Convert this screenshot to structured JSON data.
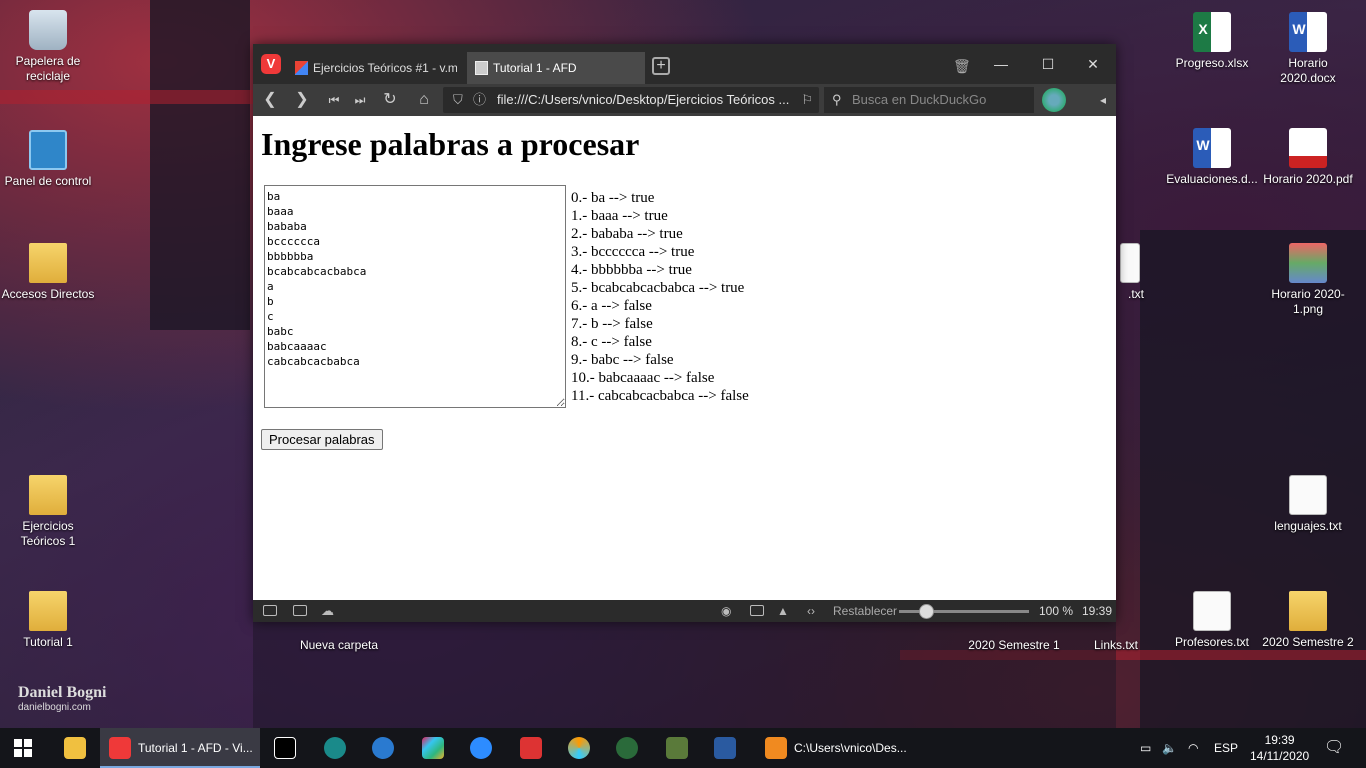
{
  "desktop": {
    "icons_left": [
      {
        "label": "Papelera de reciclaje",
        "icon": "recycle-bin-icon"
      },
      {
        "label": "Panel de control",
        "icon": "control-panel-icon"
      },
      {
        "label": "Accesos Directos",
        "icon": "folder-icon"
      },
      {
        "label": "Ejercicios Teóricos 1",
        "icon": "folder-icon"
      },
      {
        "label": "Tutorial 1",
        "icon": "folder-icon"
      }
    ],
    "icons_right": [
      {
        "label": "Progreso.xlsx",
        "icon": "excel-icon"
      },
      {
        "label": "Horario 2020.docx",
        "icon": "word-icon"
      },
      {
        "label": "Evaluaciones.d...",
        "icon": "word-icon"
      },
      {
        "label": "Horario 2020.pdf",
        "icon": "pdf-icon"
      },
      {
        "label": ".txt",
        "icon": "text-file-icon"
      },
      {
        "label": "Horario 2020-1.png",
        "icon": "image-file-icon"
      },
      {
        "label": "lenguajes.txt",
        "icon": "text-file-icon"
      },
      {
        "label": "2020 Semestre 1",
        "icon": "folder-icon"
      },
      {
        "label": "Links.txt",
        "icon": "text-file-icon"
      },
      {
        "label": "Profesores.txt",
        "icon": "text-file-icon"
      },
      {
        "label": "2020 Semestre 2",
        "icon": "folder-icon"
      },
      {
        "label": "Nueva carpeta",
        "icon": "folder-icon"
      }
    ],
    "wallpaper_name": "Daniel Bogni",
    "wallpaper_site": "danielbogni.com"
  },
  "browser": {
    "tabs": [
      {
        "label": "Ejercicios Teóricos #1 - v.m...",
        "icon": "gmail-icon"
      },
      {
        "label": "Tutorial 1 - AFD",
        "icon": "page-icon"
      }
    ],
    "url": "file:///C:/Users/vnico/Desktop/Ejercicios Teóricos ...",
    "search_placeholder": "Busca en DuckDuckGo",
    "status": {
      "reset_label": "Restablecer",
      "zoom": "100 %",
      "time": "19:39"
    }
  },
  "page": {
    "title": "Ingrese palabras a procesar",
    "input_text": "ba\nbaaa\nbababa\nbcccccca\nbbbbbba\nbcabcabcacbabca\na\nb\nc\nbabc\nbabcaaaac\ncabcabcacbabca",
    "results": [
      "0.- ba --> true",
      "1.- baaa --> true",
      "2.- bababa --> true",
      "3.- bcccccca --> true",
      "4.- bbbbbba --> true",
      "5.- bcabcabcacbabca --> true",
      "6.- a --> false",
      "7.- b --> false",
      "8.- c --> false",
      "9.- babc --> false",
      "10.- babcaaaac --> false",
      "11.- cabcabcacbabca --> false"
    ],
    "button_label": "Procesar palabras"
  },
  "taskbar": {
    "active_app": "Tutorial 1 - AFD - Vi...",
    "explorer_window": "C:\\Users\\vnico\\Des...",
    "lang": "ESP",
    "time": "19:39",
    "date": "14/11/2020"
  },
  "colors": {
    "accent": "#ef3939",
    "tab_bg": "#2b2b2b",
    "nav_bg": "#3c3c3c"
  }
}
